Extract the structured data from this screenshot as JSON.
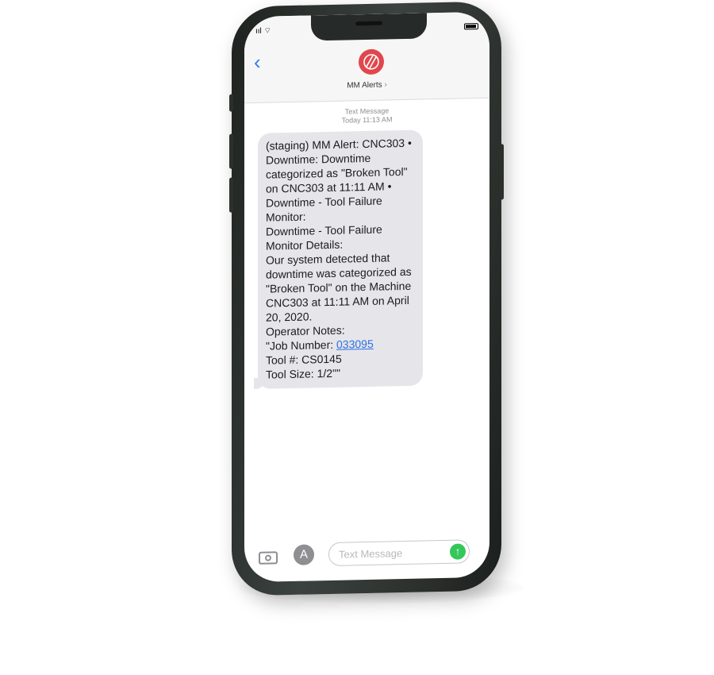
{
  "status_bar": {
    "signal": "ııl ⌔"
  },
  "header": {
    "back_icon": "chevron-left-icon",
    "contact_name": "MM Alerts",
    "contact_chevron": "›"
  },
  "conversation": {
    "meta_label": "Text Message",
    "meta_time": "Today 11:13 AM",
    "message_before_link": "(staging) MM Alert: CNC303 •\nDowntime: Downtime\ncategorized as \"Broken Tool\"\non CNC303 at 11:11 AM •\nDowntime - Tool Failure\nMonitor:\nDowntime - Tool Failure\nMonitor Details:\nOur system detected that\ndowntime was categorized as\n\"Broken Tool\" on the Machine\nCNC303 at 11:11 AM on April\n20, 2020.\nOperator Notes:\n\"Job Number: ",
    "message_link": "033095",
    "message_after_link": "\nTool #: CS0145\nTool Size: 1/2\"\""
  },
  "composer": {
    "placeholder": "Text Message",
    "camera_icon": "camera-icon",
    "appstore_icon": "appstore-icon",
    "appstore_glyph": "A",
    "send_glyph": "↑"
  },
  "colors": {
    "accent_blue": "#2f7bf6",
    "avatar_red": "#e0474c",
    "bubble_gray": "#e5e5ea",
    "send_green": "#34c759"
  }
}
